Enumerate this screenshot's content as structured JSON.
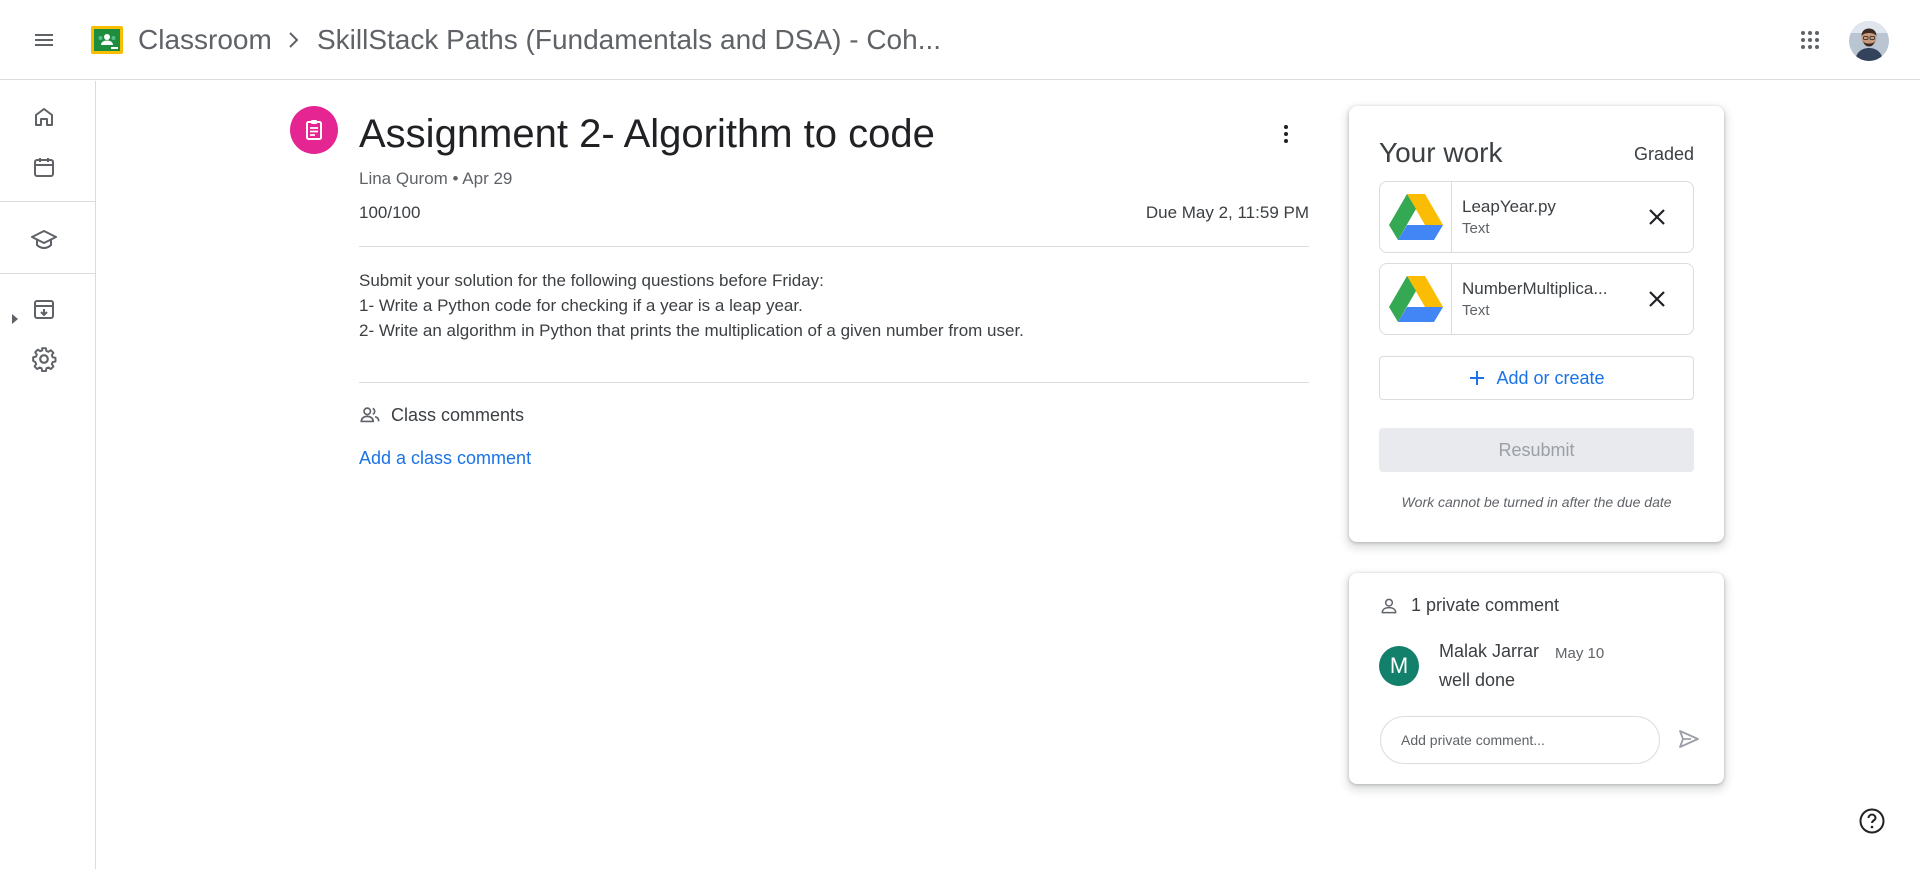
{
  "header": {
    "app_name": "Classroom",
    "course_name": "SkillStack Paths (Fundamentals and DSA) - Coh...",
    "icons": [
      "menu-icon",
      "classroom-logo",
      "chevron-right-icon",
      "apps-grid-icon",
      "user-avatar"
    ]
  },
  "sidebar": {
    "items": [
      {
        "name": "home",
        "icon": "home-icon"
      },
      {
        "name": "calendar",
        "icon": "calendar-icon"
      },
      {
        "name": "enrolled",
        "icon": "school-cap-icon"
      },
      {
        "name": "to-do",
        "icon": "archive-download-icon"
      },
      {
        "name": "settings",
        "icon": "gear-icon"
      }
    ]
  },
  "assignment": {
    "title": "Assignment 2- Algorithm to code",
    "meta": "Lina Qurom • Apr 29",
    "points": "100/100",
    "due": "Due May 2, 11:59 PM",
    "instructions": [
      "Submit your solution for the following questions before Friday:",
      "1- Write a Python code for checking if a year is a leap year.",
      "2- Write an algorithm in Python that prints the multiplication of a given number from user."
    ],
    "class_comments_label": "Class comments",
    "add_class_comment": "Add a class comment"
  },
  "your_work": {
    "title": "Your work",
    "status": "Graded",
    "attachments": [
      {
        "name": "LeapYear.py",
        "type": "Text"
      },
      {
        "name": "NumberMultiplica...",
        "type": "Text"
      }
    ],
    "add_or_create": "Add or create",
    "resubmit": "Resubmit",
    "note": "Work cannot be turned in after the due date"
  },
  "private_comments": {
    "header": "1 private comment",
    "comments": [
      {
        "initial": "M",
        "author": "Malak Jarrar",
        "date": "May 10",
        "text": "well done"
      }
    ],
    "input_placeholder": "Add private comment..."
  },
  "colors": {
    "accent_blue": "#1a73e8",
    "assignment_pink": "#e52592",
    "avatar_teal": "#12806a",
    "divider": "#dadce0"
  }
}
